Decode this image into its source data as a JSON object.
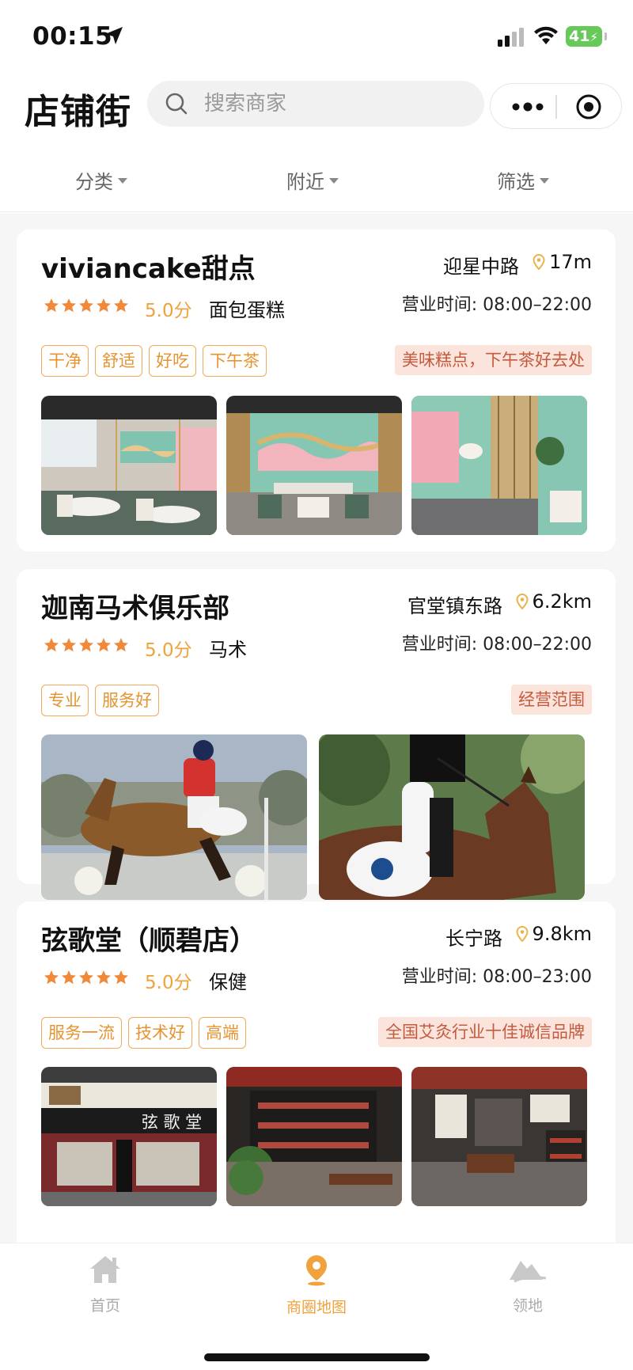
{
  "status_bar": {
    "time": "00:15",
    "battery": "41"
  },
  "header": {
    "title": "店铺街",
    "search_placeholder": "搜索商家"
  },
  "filters": [
    {
      "label": "分类"
    },
    {
      "label": "附近"
    },
    {
      "label": "筛选"
    }
  ],
  "shops": [
    {
      "name": "viviancake甜点",
      "address": "迎星中路",
      "distance": "17m",
      "rating": 5,
      "score": "5.0分",
      "category": "面包蛋糕",
      "hours": "营业时间: 08:00–22:00",
      "tags": [
        "干净",
        "舒适",
        "好吃",
        "下午茶"
      ],
      "promo": "美味糕点，下午茶好去处",
      "photos": [
        "cafe-interior-photo",
        "cafe-interior-photo",
        "cafe-interior-photo"
      ]
    },
    {
      "name": "迦南马术俱乐部",
      "address": "官堂镇东路",
      "distance": "6.2km",
      "rating": 5,
      "score": "5.0分",
      "category": "马术",
      "hours": "营业时间: 08:00–22:00",
      "tags": [
        "专业",
        "服务好"
      ],
      "promo": "经营范围",
      "photos": [
        "horse-jumping-photo",
        "horse-riding-photo"
      ]
    },
    {
      "name": "弦歌堂（顺碧店）",
      "address": "长宁路",
      "distance": "9.8km",
      "rating": 5,
      "score": "5.0分",
      "category": "保健",
      "hours": "营业时间: 08:00–23:00",
      "tags": [
        "服务一流",
        "技术好",
        "高端"
      ],
      "promo": "全国艾灸行业十佳诚信品牌",
      "storefront_sign": "弦 歌 堂",
      "photos": [
        "storefront-photo",
        "shop-interior-photo",
        "shop-interior-photo"
      ]
    }
  ],
  "tab_bar": [
    {
      "label": "首页",
      "icon": "home-icon"
    },
    {
      "label": "商圈地图",
      "icon": "map-pin-icon",
      "active": true
    },
    {
      "label": "领地",
      "icon": "territory-icon"
    }
  ],
  "colors": {
    "accent": "#f0a23c",
    "tag_border": "#f2a95a",
    "promo_bg": "#fbe4dc",
    "star": "#f08a3a",
    "battery": "#68c95b"
  }
}
